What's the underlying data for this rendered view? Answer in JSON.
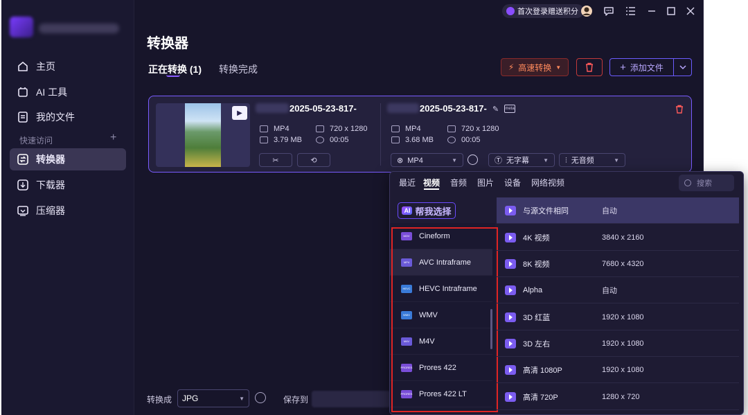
{
  "sidebar": {
    "items": [
      {
        "label": "主页",
        "icon": "home-icon"
      },
      {
        "label": "AI 工具",
        "icon": "ai-tools-icon"
      },
      {
        "label": "我的文件",
        "icon": "my-files-icon"
      }
    ],
    "quick_access": "快速访问",
    "quick_items": [
      {
        "label": "转换器",
        "icon": "converter-icon",
        "active": true
      },
      {
        "label": "下载器",
        "icon": "downloader-icon"
      },
      {
        "label": "压缩器",
        "icon": "compressor-icon"
      }
    ]
  },
  "topbar": {
    "promo": "首次登录赠送积分"
  },
  "page": {
    "title": "转换器",
    "tabs": [
      "正在转换 (1)",
      "转换完成"
    ],
    "buttons": {
      "high_speed": "高速转换",
      "add_file": "添加文件"
    }
  },
  "file": {
    "source": {
      "name": "2025-05-23-817-",
      "format": "MP4",
      "resolution": "720 x 1280",
      "size": "3.79 MB",
      "duration": "00:05"
    },
    "target": {
      "name": "2025-05-23-817-",
      "format": "MP4",
      "resolution": "720 x 1280",
      "size": "3.68 MB",
      "duration": "00:05"
    },
    "format_select": "MP4",
    "subtitle_select": "无字幕",
    "audio_select": "无音频"
  },
  "bottom": {
    "convert_to_label": "转换成",
    "convert_to_value": "JPG",
    "save_to_label": "保存到"
  },
  "panel": {
    "tabs": [
      "最近",
      "视频",
      "音频",
      "图片",
      "设备",
      "网络视频"
    ],
    "search_placeholder": "搜索",
    "ai_button": "帮我选择",
    "ai_badge": "AI",
    "left_formats": [
      {
        "label": "Cineform",
        "badge": "MOV"
      },
      {
        "label": "AVC Intraframe",
        "badge": "MP4"
      },
      {
        "label": "HEVC Intraframe",
        "badge": "HEVC"
      },
      {
        "label": "WMV",
        "badge": "WMV"
      },
      {
        "label": "M4V",
        "badge": "M4V"
      },
      {
        "label": "Prores 422",
        "badge": "PRORES"
      },
      {
        "label": "Prores 422 LT",
        "badge": "PRORES"
      }
    ],
    "right_presets": [
      {
        "name": "与源文件相同",
        "res": "自动"
      },
      {
        "name": "4K 视频",
        "res": "3840 x 2160"
      },
      {
        "name": "8K 视频",
        "res": "7680 x 4320"
      },
      {
        "name": "Alpha",
        "res": "自动"
      },
      {
        "name": "3D 红蓝",
        "res": "1920 x 1080"
      },
      {
        "name": "3D 左右",
        "res": "1920 x 1080"
      },
      {
        "name": "高清 1080P",
        "res": "1920 x 1080"
      },
      {
        "name": "高清 720P",
        "res": "1280 x 720"
      }
    ]
  }
}
